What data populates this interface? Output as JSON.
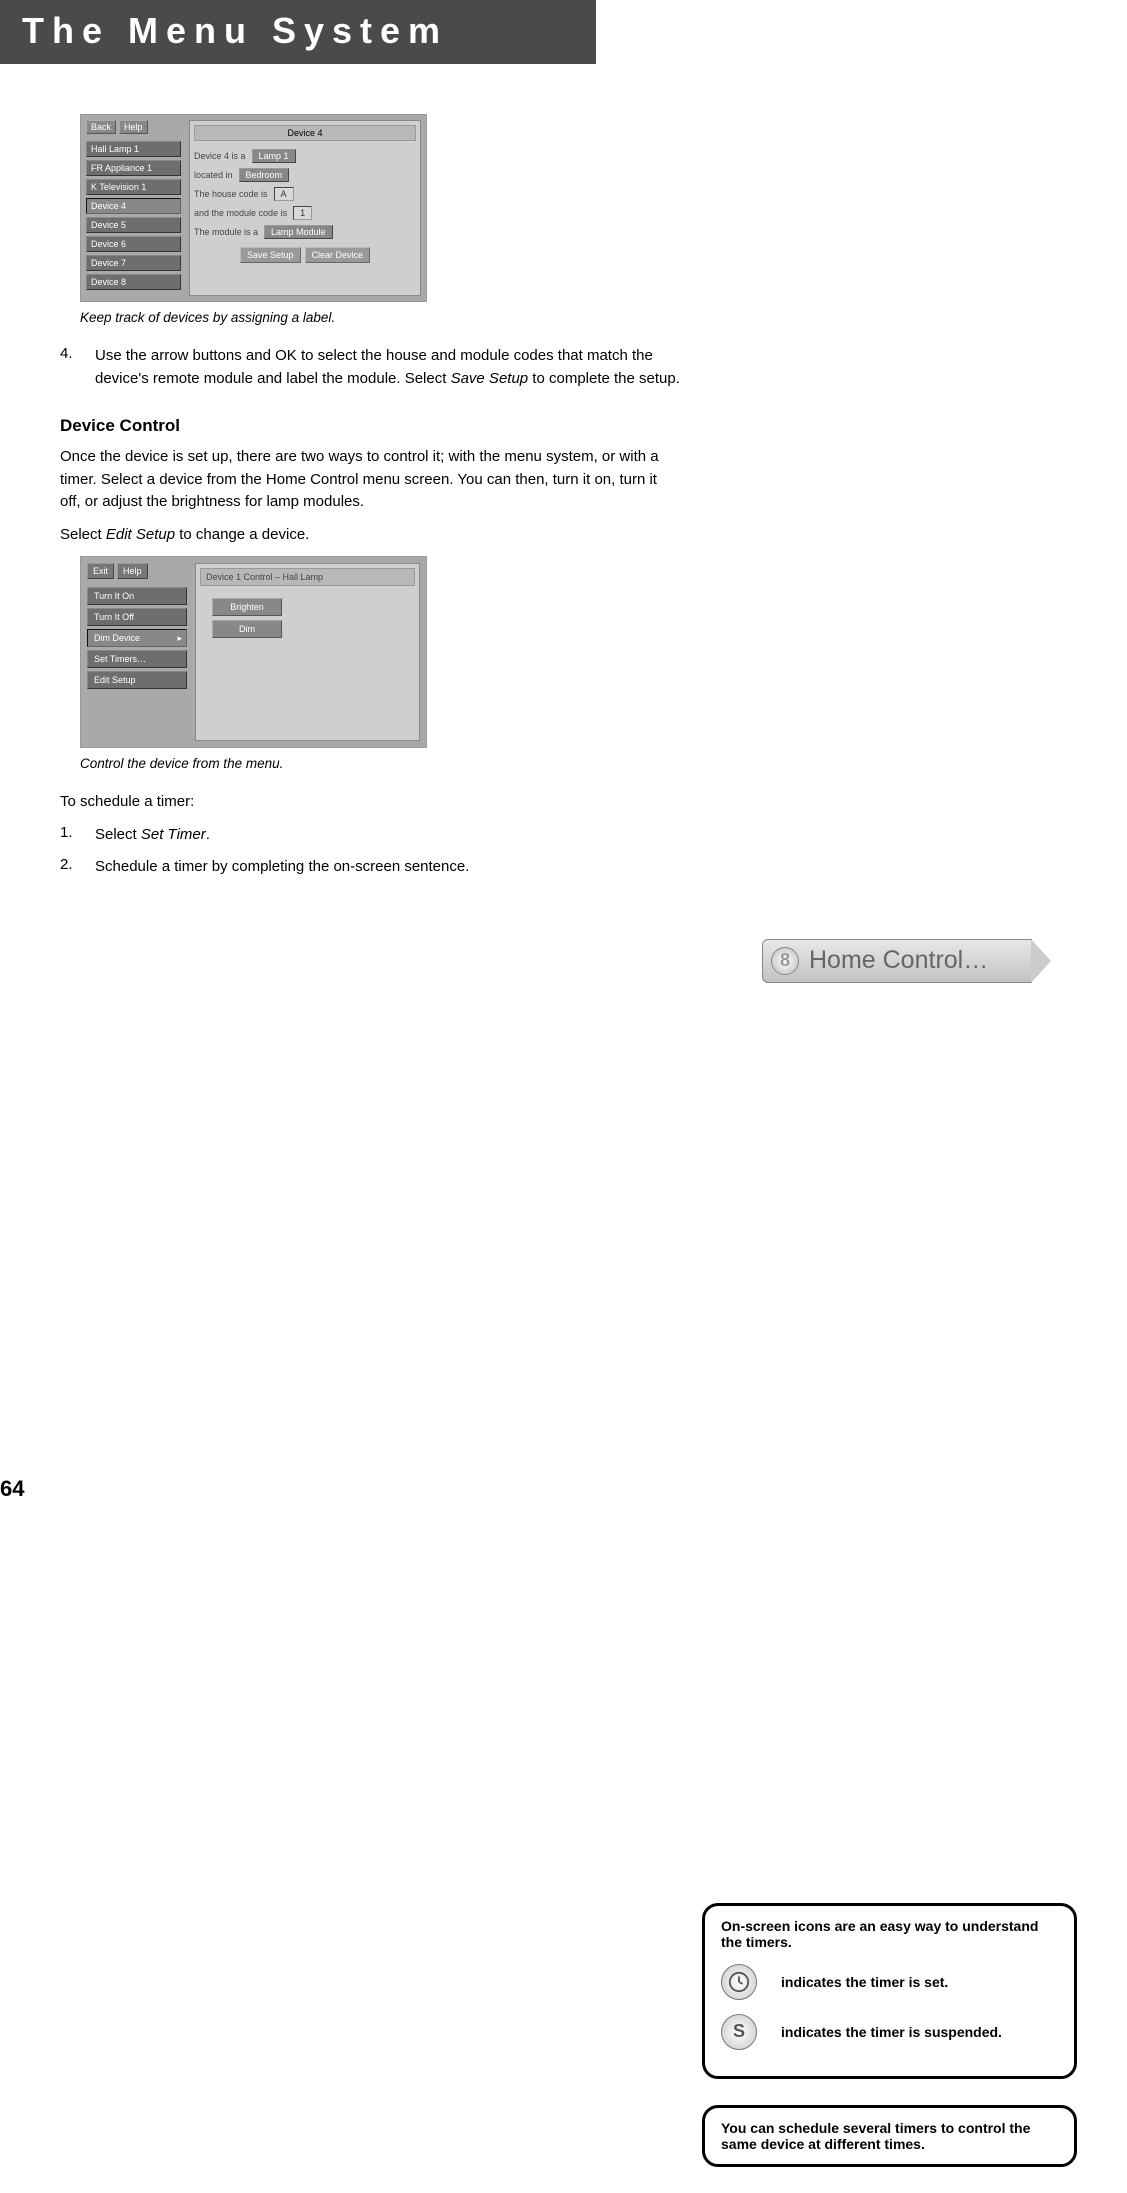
{
  "title": "The Menu System",
  "page_number": "64",
  "screenshot1": {
    "top_buttons": [
      "Back",
      "Help"
    ],
    "sidebar": [
      "Hall Lamp 1",
      "FR Appliance 1",
      "K Television 1",
      "Device 4",
      "Device 5",
      "Device 6",
      "Device 7",
      "Device 8"
    ],
    "tab": "Device 4",
    "line1_label": "Device 4 is a",
    "line1_value": "Lamp 1",
    "line2_label": "located in",
    "line2_value": "Bedroom",
    "line3_label": "The house code is",
    "line3_value": "A",
    "line4_label": "and the module code is",
    "line4_value": "1",
    "line5_label": "The module is a",
    "line5_value": "Lamp Module",
    "btn_save": "Save Setup",
    "btn_clear": "Clear Device",
    "caption": "Keep track of devices by assigning a label."
  },
  "step4": {
    "num": "4.",
    "text_a": "Use the arrow buttons and OK to select the house and module codes that match the device's remote module and label the module. Select ",
    "italic": "Save Setup",
    "text_b": " to complete the setup."
  },
  "h2": "Device Control",
  "para1": "Once the device is set up, there are two ways to control it; with the menu system, or with a timer. Select a device from the Home Control menu screen. You can then, turn it on, turn it off, or adjust the brightness for lamp modules.",
  "para2_a": "Select ",
  "para2_italic": "Edit Setup",
  "para2_b": " to change a device.",
  "screenshot2": {
    "top_buttons": [
      "Exit",
      "Help"
    ],
    "sidebar": [
      "Turn It On",
      "Turn It Off",
      "Dim Device",
      "Set Timers…",
      "Edit Setup"
    ],
    "tab": "Device 1 Control –  Hall Lamp",
    "btn_brighten": "Brighten",
    "btn_dim": "Dim",
    "caption": "Control the device from the menu."
  },
  "para3": "To schedule a timer:",
  "step1": {
    "num": "1.",
    "text_a": "Select ",
    "italic": "Set Timer",
    "text_b": "."
  },
  "step2": {
    "num": "2.",
    "text": "Schedule a timer by completing the on-screen sentence."
  },
  "badge": {
    "icon": "8",
    "label": "Home Control…"
  },
  "sidebox1": {
    "intro": "On-screen icons are an easy way to understand the timers.",
    "row1": "indicates the timer is set.",
    "row2": "indicates the timer is suspended."
  },
  "sidebox2": "You can schedule several timers to control the same device at different times."
}
